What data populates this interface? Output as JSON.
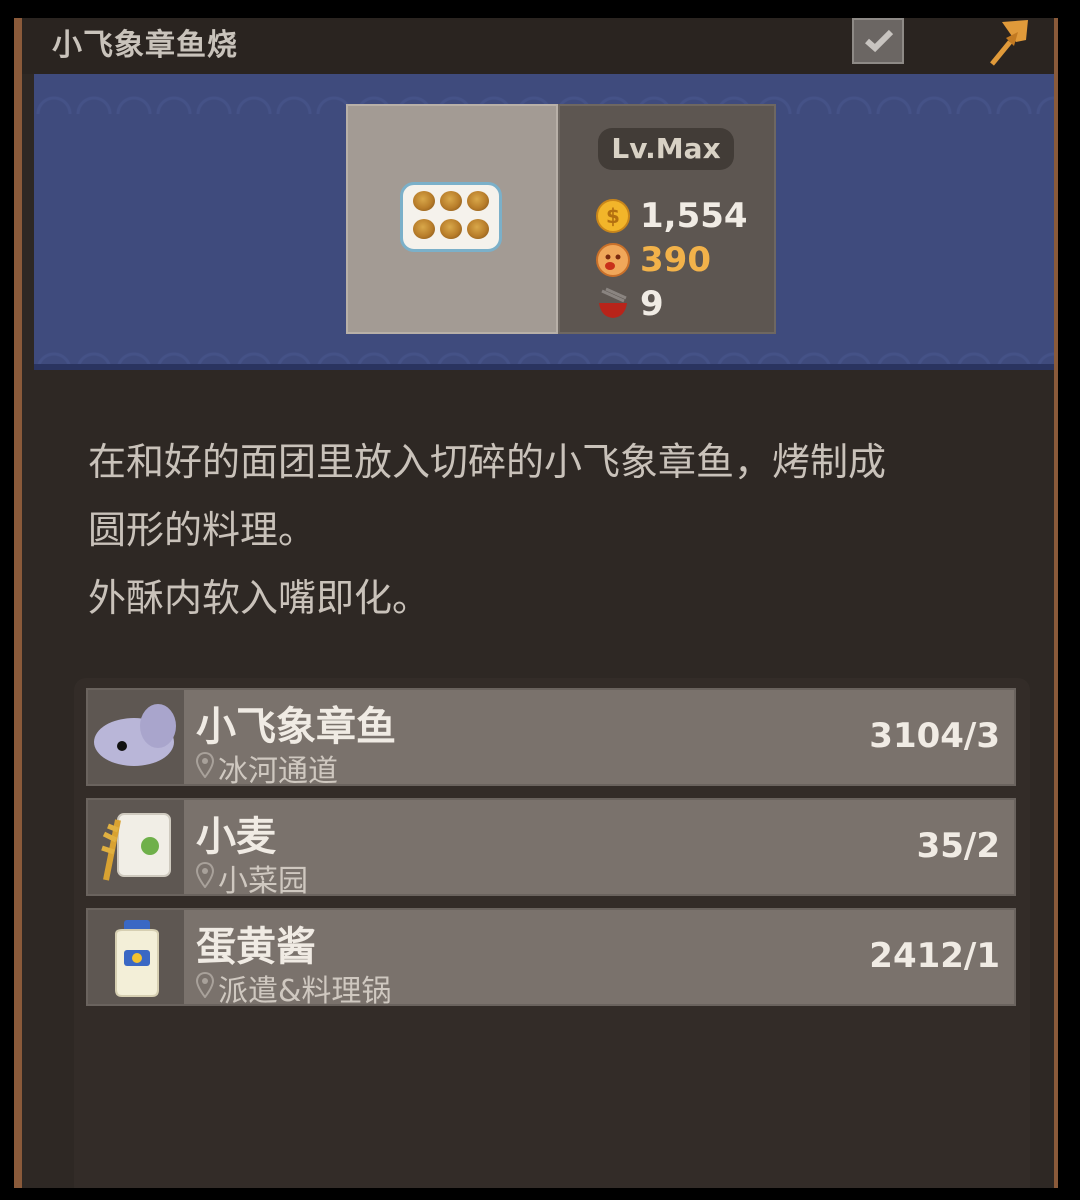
{
  "header": {
    "title": "小飞象章鱼烧"
  },
  "dish": {
    "level_label": "Lv.Max",
    "stats": [
      {
        "icon": "coin-icon",
        "value": "1,554",
        "color": "#f0ebe4"
      },
      {
        "icon": "taste-face-icon",
        "value": "390",
        "color": "#f2b24a"
      },
      {
        "icon": "bowl-icon",
        "value": "9",
        "color": "#f0ebe4"
      }
    ]
  },
  "description": {
    "line1": "在和好的面团里放入切碎的小飞象章鱼，烤制成",
    "line2": "圆形的料理。",
    "line3": "外酥内软入嘴即化。"
  },
  "ingredients": [
    {
      "name": "小飞象章鱼",
      "location": "冰河通道",
      "count": "3104/3",
      "icon": "octopus-icon"
    },
    {
      "name": "小麦",
      "location": "小菜园",
      "count": "35/2",
      "icon": "wheat-icon"
    },
    {
      "name": "蛋黄酱",
      "location": "派遣&料理锅",
      "count": "2412/1",
      "icon": "mayonnaise-icon"
    }
  ]
}
